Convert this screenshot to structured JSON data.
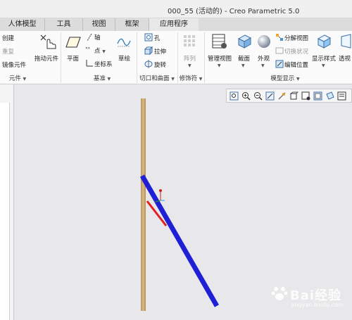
{
  "window": {
    "title": "000_55 (活动的) - Creo Parametric 5.0"
  },
  "tabs": [
    "人体模型",
    "工具",
    "视图",
    "框架",
    "应用程序"
  ],
  "ribbon": {
    "component": {
      "create": "创建",
      "repeat": "重复",
      "mirror": "镜像元件",
      "label": "元件"
    },
    "drag": {
      "label": "拖动元件"
    },
    "datum": {
      "plane": "平面",
      "axis": "轴",
      "point": "点",
      "csys": "坐标系",
      "sketch": "草绘",
      "label": "基准"
    },
    "cut_surface": {
      "hole": "孔",
      "extrude": "拉伸",
      "revolve": "旋转",
      "label": "切口和曲面"
    },
    "modifiers": {
      "pattern": "阵列",
      "label": "修饰符"
    },
    "model_display": {
      "manage_views": "管理视图",
      "section": "截面",
      "appearance": "外观",
      "explode": "分解视图",
      "toggle_status": "切换状况",
      "edit_position": "编辑位置",
      "display_style": "显示样式",
      "perspective": "透视",
      "label": "模型显示"
    }
  },
  "watermark": {
    "text": "Bai经验",
    "sub": "jingyan.baidu.com"
  },
  "colors": {
    "bar": "#c9a66b",
    "beam": "#1f1fd6",
    "accent_red": "#e02020"
  }
}
